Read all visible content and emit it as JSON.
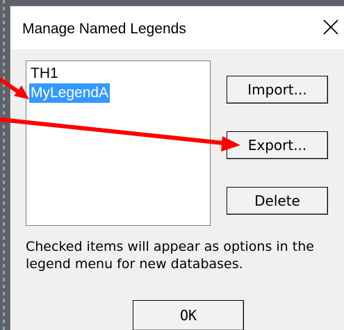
{
  "dialog": {
    "title": "Manage Named Legends",
    "close_icon": "close-icon"
  },
  "legend_list": {
    "items": [
      {
        "label": "TH1",
        "selected": false
      },
      {
        "label": "MyLegendA",
        "selected": true
      }
    ],
    "selection_color": "#3399ff"
  },
  "buttons": {
    "import_label": "Import...",
    "export_label": "Export...",
    "delete_label": "Delete",
    "ok_label": "OK"
  },
  "help": {
    "line1": "Checked items will appear as options in the",
    "line2": "legend menu for new databases."
  },
  "annotations": {
    "arrow_color": "#ff0000",
    "arrow_icon": "red-arrow-icon"
  }
}
